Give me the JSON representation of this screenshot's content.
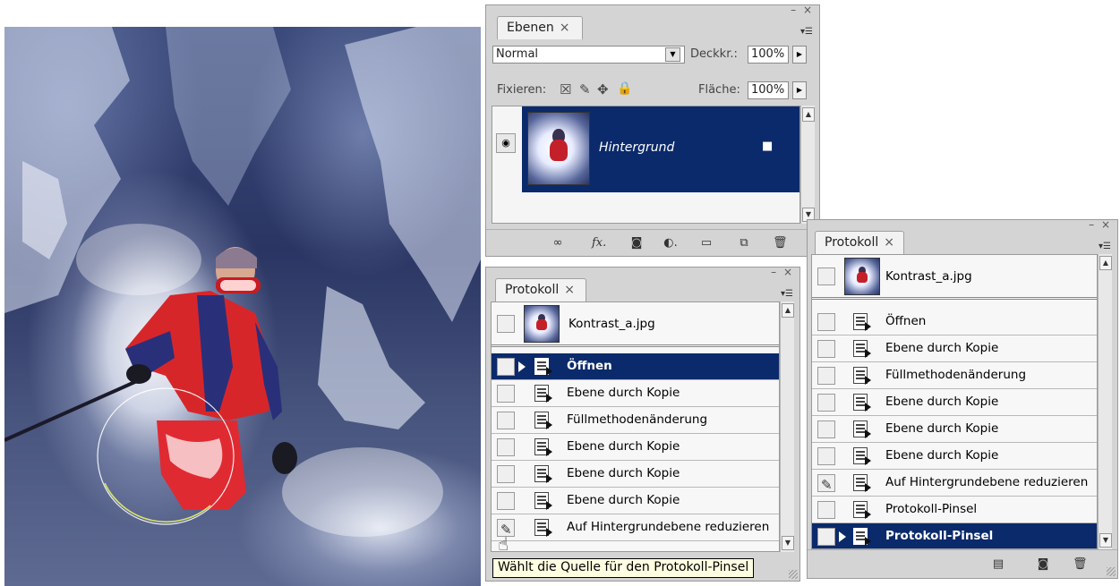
{
  "ebenen": {
    "tab_label": "Ebenen",
    "tab_close": "×",
    "window_controls": "– ×",
    "blend_mode": "Normal",
    "opacity_label": "Deckkr.:",
    "opacity_value": "100%",
    "lock_label": "Fixieren:",
    "fill_label": "Fläche:",
    "fill_value": "100%",
    "layer_name": "Hintergrund",
    "bottom_tools": [
      "link-icon",
      "fx-icon",
      "mask-icon",
      "adjustment-icon",
      "folder-icon",
      "new-layer-icon",
      "trash-icon"
    ]
  },
  "protokoll_left": {
    "tab_label": "Protokoll",
    "tab_close": "×",
    "window_controls": "– ×",
    "snapshot": "Kontrast_a.jpg",
    "items": [
      {
        "label": "Öffnen",
        "selected": true,
        "source": false
      },
      {
        "label": "Ebene durch Kopie",
        "selected": false,
        "source": false
      },
      {
        "label": "Füllmethodenänderung",
        "selected": false,
        "source": false
      },
      {
        "label": "Ebene durch Kopie",
        "selected": false,
        "source": false
      },
      {
        "label": "Ebene durch Kopie",
        "selected": false,
        "source": false
      },
      {
        "label": "Ebene durch Kopie",
        "selected": false,
        "source": false
      },
      {
        "label": "Auf Hintergrundebene reduzieren",
        "selected": false,
        "source": true
      }
    ]
  },
  "protokoll_right": {
    "tab_label": "Protokoll",
    "tab_close": "×",
    "window_controls": "– ×",
    "snapshot": "Kontrast_a.jpg",
    "items": [
      {
        "label": "Öffnen",
        "selected": false,
        "source": false
      },
      {
        "label": "Ebene durch Kopie",
        "selected": false,
        "source": false
      },
      {
        "label": "Füllmethodenänderung",
        "selected": false,
        "source": false
      },
      {
        "label": "Ebene durch Kopie",
        "selected": false,
        "source": false
      },
      {
        "label": "Ebene durch Kopie",
        "selected": false,
        "source": false
      },
      {
        "label": "Ebene durch Kopie",
        "selected": false,
        "source": false
      },
      {
        "label": "Auf Hintergrundebene reduzieren",
        "selected": false,
        "source": true
      },
      {
        "label": "Protokoll-Pinsel",
        "selected": false,
        "source": false
      },
      {
        "label": "Protokoll-Pinsel",
        "selected": true,
        "source": false
      }
    ],
    "bottom_tools": [
      "new-document-icon",
      "camera-icon",
      "trash-icon"
    ]
  },
  "tooltip": "Wählt die Quelle für den Protokoll-Pinsel",
  "colors": {
    "selection": "#0b2a6b",
    "panel_bg": "#d4d4d4",
    "tooltip_bg": "#ffffe1"
  }
}
